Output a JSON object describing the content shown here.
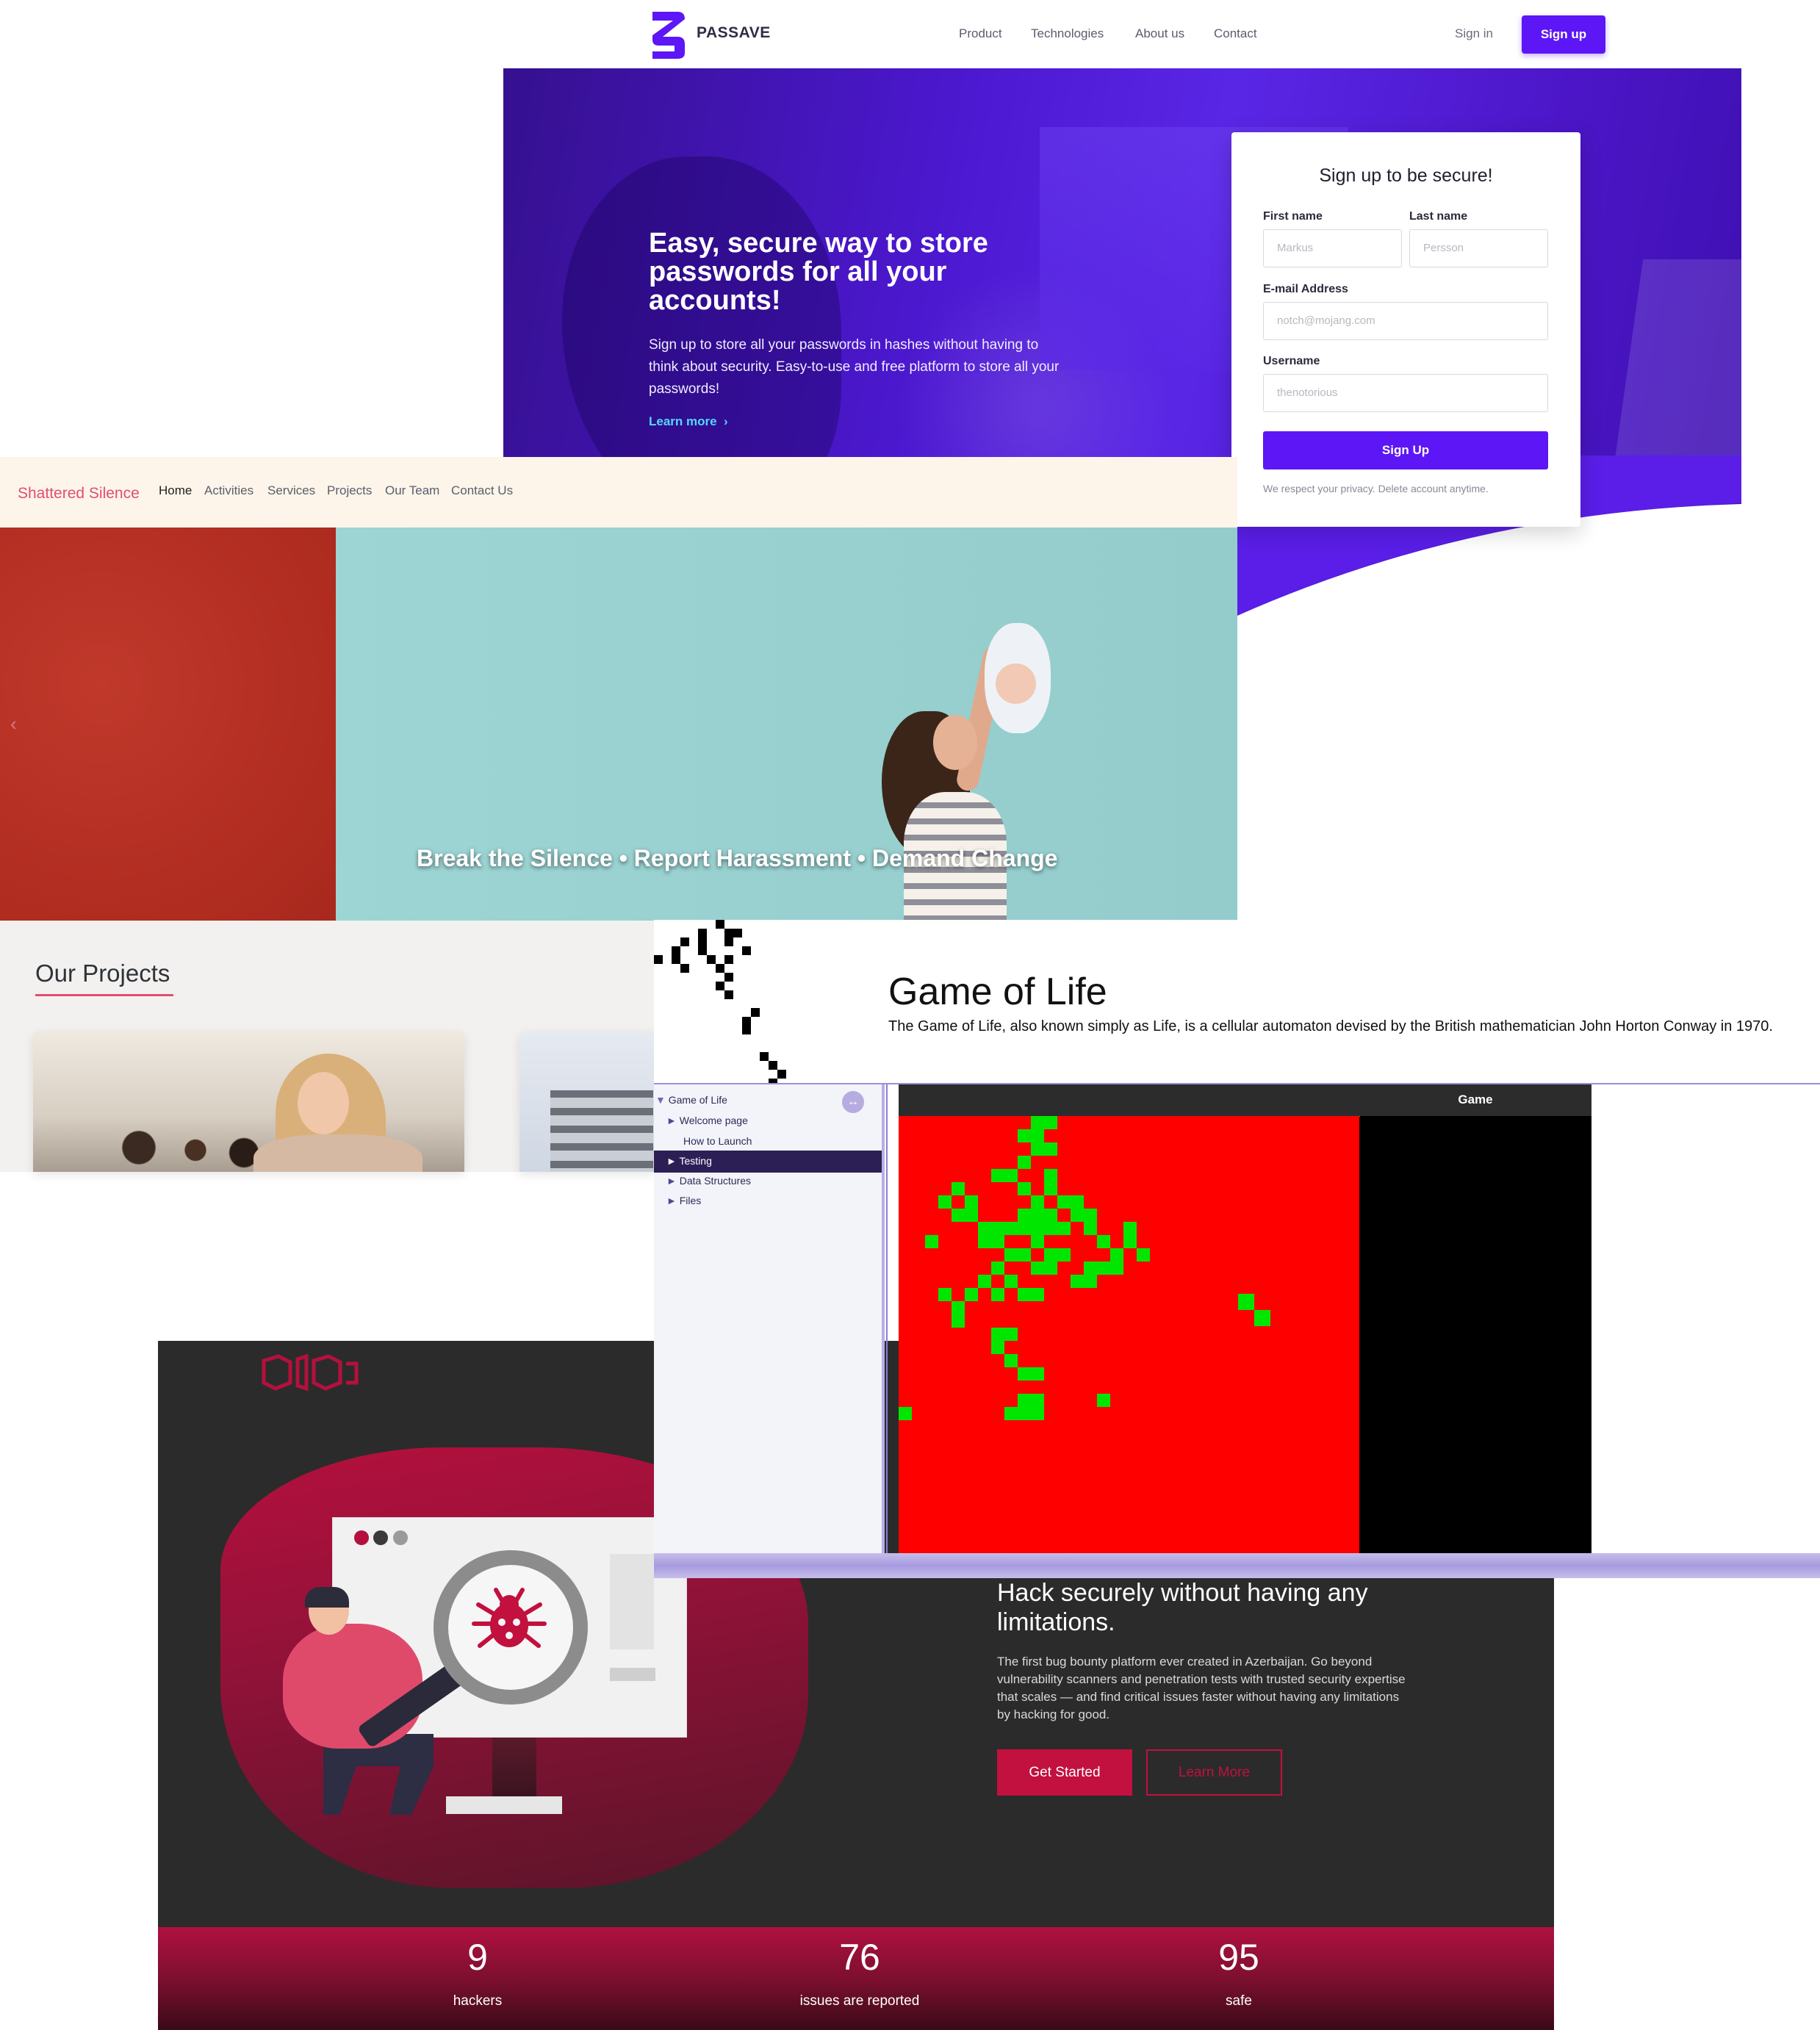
{
  "passave": {
    "brand": "PASSAVE",
    "nav": [
      "Product",
      "Technologies",
      "About us",
      "Contact"
    ],
    "sign_in": "Sign in",
    "sign_up": "Sign up",
    "hero_title": "Easy, secure way to store passwords for all your accounts!",
    "hero_desc": "Sign up to store all your passwords in hashes without having to think about security. Easy-to-use and free platform to store all your passwords!",
    "learn_more": "Learn more",
    "form": {
      "title": "Sign up to be secure!",
      "first_name_label": "First name",
      "first_name_placeholder": "Markus",
      "last_name_label": "Last name",
      "last_name_placeholder": "Persson",
      "email_label": "E-mail Address",
      "email_placeholder": "notch@mojang.com",
      "username_label": "Username",
      "username_placeholder": "thenotorious",
      "submit": "Sign Up",
      "privacy": "We respect your privacy. Delete account anytime."
    },
    "accent": "#5d16f5"
  },
  "shattered": {
    "brand": "Shattered Silence",
    "nav": [
      "Home",
      "Activities",
      "Services",
      "Projects",
      "Our Team",
      "Contact Us"
    ],
    "prev_arrow": "‹",
    "caption": "Break the Silence • Report Harassment • Demand Change",
    "projects_title": "Our Projects",
    "accent": "#e04e74"
  },
  "gol": {
    "title": "Game of Life",
    "desc": "The Game of Life, also known simply as Life, is a cellular automaton devised by the British mathematician John Horton Conway in 1970.",
    "tree": {
      "root": "Game of Life",
      "items": [
        "Welcome page",
        "How to Launch",
        "Testing",
        "Data Structures",
        "Files"
      ],
      "selected": "Testing",
      "toggle_icon": "↔"
    },
    "game_label": "Game",
    "colors": {
      "dead": "#ff0000",
      "alive": "#00ee00"
    }
  },
  "bugbounty": {
    "headline": "Hack securely without having any limitations.",
    "desc": "The first bug bounty platform ever created in Azerbaijan. Go beyond vulnerability scanners and penetration tests with trusted security expertise that scales — and find critical issues faster without having any limitations by hacking for good.",
    "get_started": "Get Started",
    "learn_more": "Learn More",
    "stats": [
      {
        "value": "9",
        "label": "hackers"
      },
      {
        "value": "76",
        "label": "issues are reported"
      },
      {
        "value": "95",
        "label": "safe"
      }
    ],
    "accent": "#c2103f"
  }
}
